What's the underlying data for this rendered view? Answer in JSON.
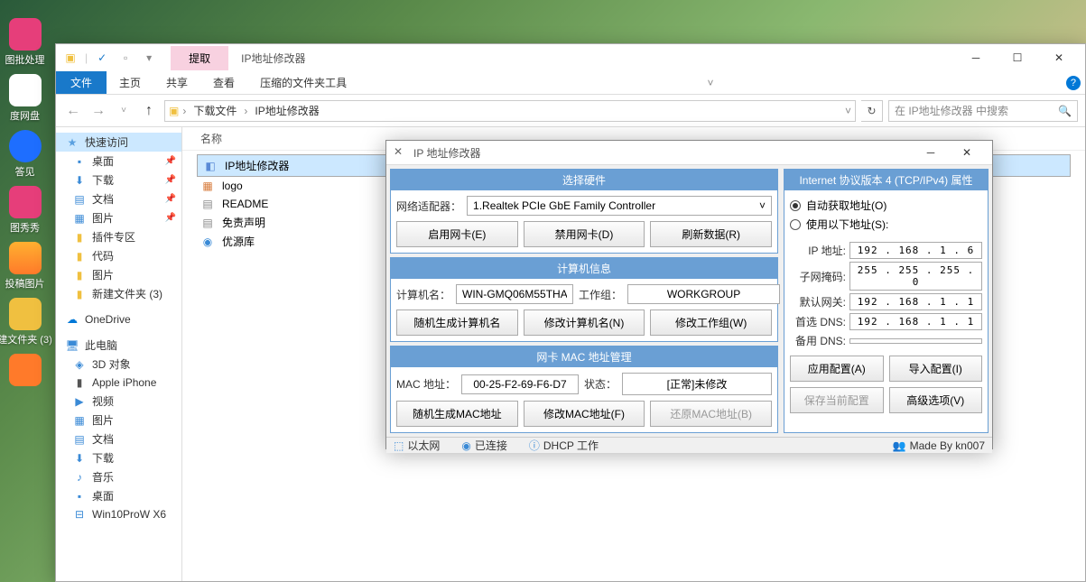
{
  "desktop": {
    "icons": [
      {
        "label": "图批处理",
        "color": "#e63e7a"
      },
      {
        "label": "度网盘",
        "color": "#fff"
      },
      {
        "label": "答见",
        "color": "#1e6eff"
      },
      {
        "label": "图秀秀",
        "color": "#e63e7a"
      },
      {
        "label": "投稿图片",
        "color": "#ffb030"
      },
      {
        "label": "建文件夹 (3)",
        "color": "#f0c040"
      },
      {
        "label": "",
        "color": "#ff7a2a"
      }
    ]
  },
  "explorer": {
    "extract_tab": "提取",
    "title": "IP地址修改器",
    "ribbon": {
      "file": "文件",
      "tabs": [
        "主页",
        "共享",
        "查看",
        "压缩的文件夹工具"
      ]
    },
    "breadcrumb": [
      "下载文件",
      "IP地址修改器"
    ],
    "search_placeholder": "在 IP地址修改器 中搜索",
    "col_name": "名称",
    "nav": {
      "quick": "快速访问",
      "quick_items": [
        "桌面",
        "下载",
        "文档",
        "图片",
        "插件专区",
        "代码",
        "图片",
        "新建文件夹 (3)"
      ],
      "onedrive": "OneDrive",
      "thispc": "此电脑",
      "pc_items": [
        "3D 对象",
        "Apple iPhone",
        "视频",
        "图片",
        "文档",
        "下载",
        "音乐",
        "桌面",
        "Win10ProW X6"
      ]
    },
    "files": [
      {
        "name": "IP地址修改器",
        "icon": "app"
      },
      {
        "name": "logo",
        "icon": "img"
      },
      {
        "name": "README",
        "icon": "txt"
      },
      {
        "name": "免责声明",
        "icon": "txt"
      },
      {
        "name": "优源库",
        "icon": "web"
      }
    ]
  },
  "ipwin": {
    "title": "IP 地址修改器",
    "hw": {
      "header": "选择硬件",
      "adapter_lbl": "网络适配器：",
      "adapter_val": "1.Realtek PCIe GbE Family Controller",
      "btn_enable": "启用网卡(E)",
      "btn_disable": "禁用网卡(D)",
      "btn_refresh": "刷新数据(R)"
    },
    "pc": {
      "header": "计算机信息",
      "name_lbl": "计算机名：",
      "name_val": "WIN-GMQ06M55THA",
      "wg_lbl": "工作组：",
      "wg_val": "WORKGROUP",
      "btn_rand": "随机生成计算机名",
      "btn_rename": "修改计算机名(N)",
      "btn_wg": "修改工作组(W)"
    },
    "mac": {
      "header": "网卡 MAC 地址管理",
      "mac_lbl": "MAC 地址：",
      "mac_val": "00-25-F2-69-F6-D7",
      "state_lbl": "状态：",
      "state_val": "[正常]未修改",
      "btn_rand": "随机生成MAC地址",
      "btn_mod": "修改MAC地址(F)",
      "btn_restore": "还原MAC地址(B)"
    },
    "ipv4": {
      "header": "Internet 协议版本 4 (TCP/IPv4) 属性",
      "auto": "自动获取地址(O)",
      "manual": "使用以下地址(S):",
      "ip_lbl": "IP 地址:",
      "ip_val": "192 . 168 .  1  .  6",
      "mask_lbl": "子网掩码:",
      "mask_val": "255 . 255 . 255 .  0",
      "gw_lbl": "默认网关:",
      "gw_val": "192 . 168 .  1  .  1",
      "dns1_lbl": "首选 DNS:",
      "dns1_val": "192 . 168 .  1  .  1",
      "dns2_lbl": "备用 DNS:",
      "dns2_val": "",
      "btn_apply": "应用配置(A)",
      "btn_import": "导入配置(I)",
      "btn_save": "保存当前配置",
      "btn_adv": "高级选项(V)"
    },
    "status": {
      "eth": "以太网",
      "conn": "已连接",
      "dhcp": "DHCP 工作",
      "made": "Made By kn007"
    }
  }
}
